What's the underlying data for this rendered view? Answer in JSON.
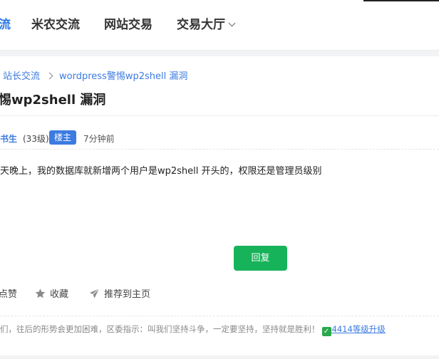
{
  "nav": {
    "items": [
      {
        "label": "流",
        "active": true
      },
      {
        "label": "米农交流"
      },
      {
        "label": "网站交易"
      },
      {
        "label": "交易大厅",
        "has_dropdown": true
      }
    ]
  },
  "breadcrumb": {
    "items": [
      "站长交流",
      "wordpress警惕wp2shell 漏洞"
    ]
  },
  "post": {
    "title": "惕wp2shell 漏洞",
    "author": "书生",
    "author_level": "(33级)",
    "badge": "楼主",
    "time": "7分钟前",
    "content": "天晚上，我的数据库就新增两个用户是wp2shell 开头的，权限还是管理员级别"
  },
  "reply_button": "回复",
  "actions": {
    "like": "点赞",
    "favorite": "收藏",
    "recommend": "推荐到主页"
  },
  "signature": {
    "text": "们，往后的形势会更加困难，区委指示：叫我们坚持斗争，一定要坚持，坚持就是胜利！",
    "check_glyph": "✓",
    "level_link": "4414等级升级"
  },
  "colors": {
    "accent": "#2b7ae4",
    "reply_green": "#17b35a",
    "check_green": "#2aa84a"
  }
}
